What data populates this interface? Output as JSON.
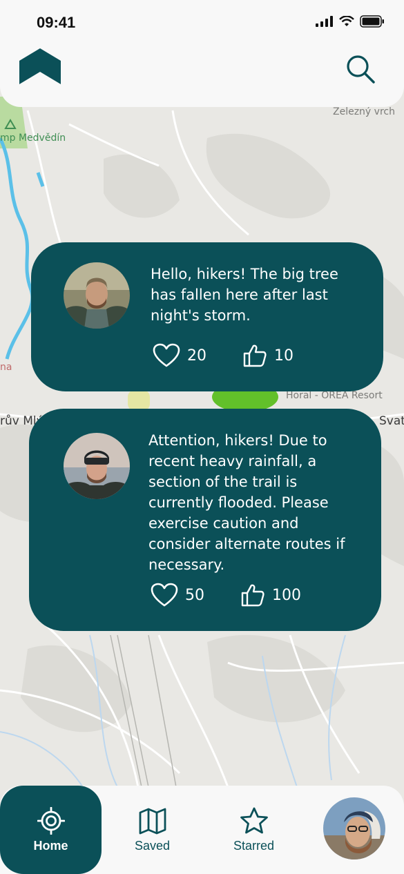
{
  "status": {
    "time": "09:41"
  },
  "map": {
    "labels": {
      "zelezny": "Železný vrch",
      "medvedin": "mp Medvědín",
      "horal": "Horal - OREA Resort",
      "mlyn": "rův Mlý",
      "svat": "Svat",
      "na": "na"
    }
  },
  "posts": [
    {
      "text_lines": [
        "Hello, hikers! The big tree",
        "has fallen here after last",
        "night's storm."
      ],
      "likes": "20",
      "thumbs": "10"
    },
    {
      "text_lines": [
        "Attention, hikers! Due to",
        "recent heavy rainfall, a",
        "section of the trail is",
        "currently flooded. Please",
        "exercise caution and",
        "consider alternate routes if",
        "necessary."
      ],
      "likes": "50",
      "thumbs": "100"
    }
  ],
  "nav": {
    "home": "Home",
    "saved": "Saved",
    "starred": "Starred"
  },
  "colors": {
    "primary": "#0b5058",
    "background": "#f8f8f8",
    "map": "#e9e8e4"
  },
  "icons": [
    "logo-icon",
    "search-icon",
    "heart-icon",
    "thumbs-up-icon",
    "target-icon",
    "map-icon",
    "star-icon"
  ]
}
